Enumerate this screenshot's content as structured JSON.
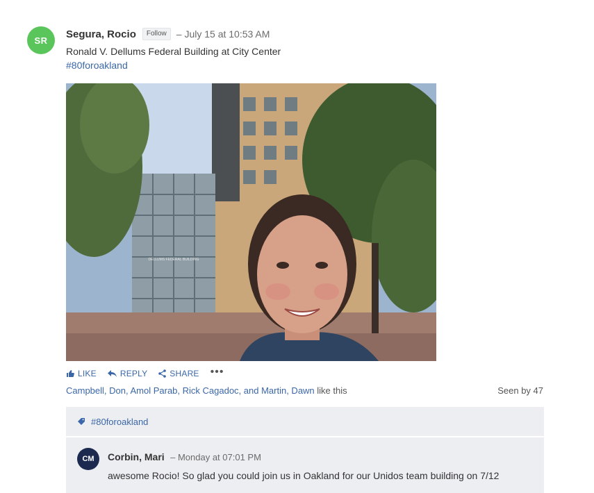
{
  "post": {
    "avatar_initials": "SR",
    "avatar_color": "#5ac55b",
    "author": "Segura, Rocio",
    "follow_label": "Follow",
    "timestamp": "– July 15 at 10:53 AM",
    "body": "Ronald V. Dellums Federal Building at City Center",
    "hashtag": "#80foroakland",
    "image_sign_text": "DELLUMS FEDERAL BUILDING"
  },
  "actions": {
    "like": "LIKE",
    "reply": "REPLY",
    "share": "SHARE",
    "more": "•••"
  },
  "likes": {
    "names": "Campbell, Don, Amol Parab, Rick Cagadoc, and Martin, Dawn",
    "suffix": " like this",
    "seen": "Seen by 47"
  },
  "topic": {
    "label": "#80foroakland"
  },
  "comment": {
    "avatar_initials": "CM",
    "avatar_color": "#1b2a4e",
    "author": "Corbin, Mari",
    "timestamp": "– Monday at 07:01 PM",
    "text": "awesome Rocio!  So glad you could join us in Oakland for our Unidos team building on 7/12"
  },
  "colors": {
    "link": "#3b67a8",
    "panel": "#eceef1"
  }
}
